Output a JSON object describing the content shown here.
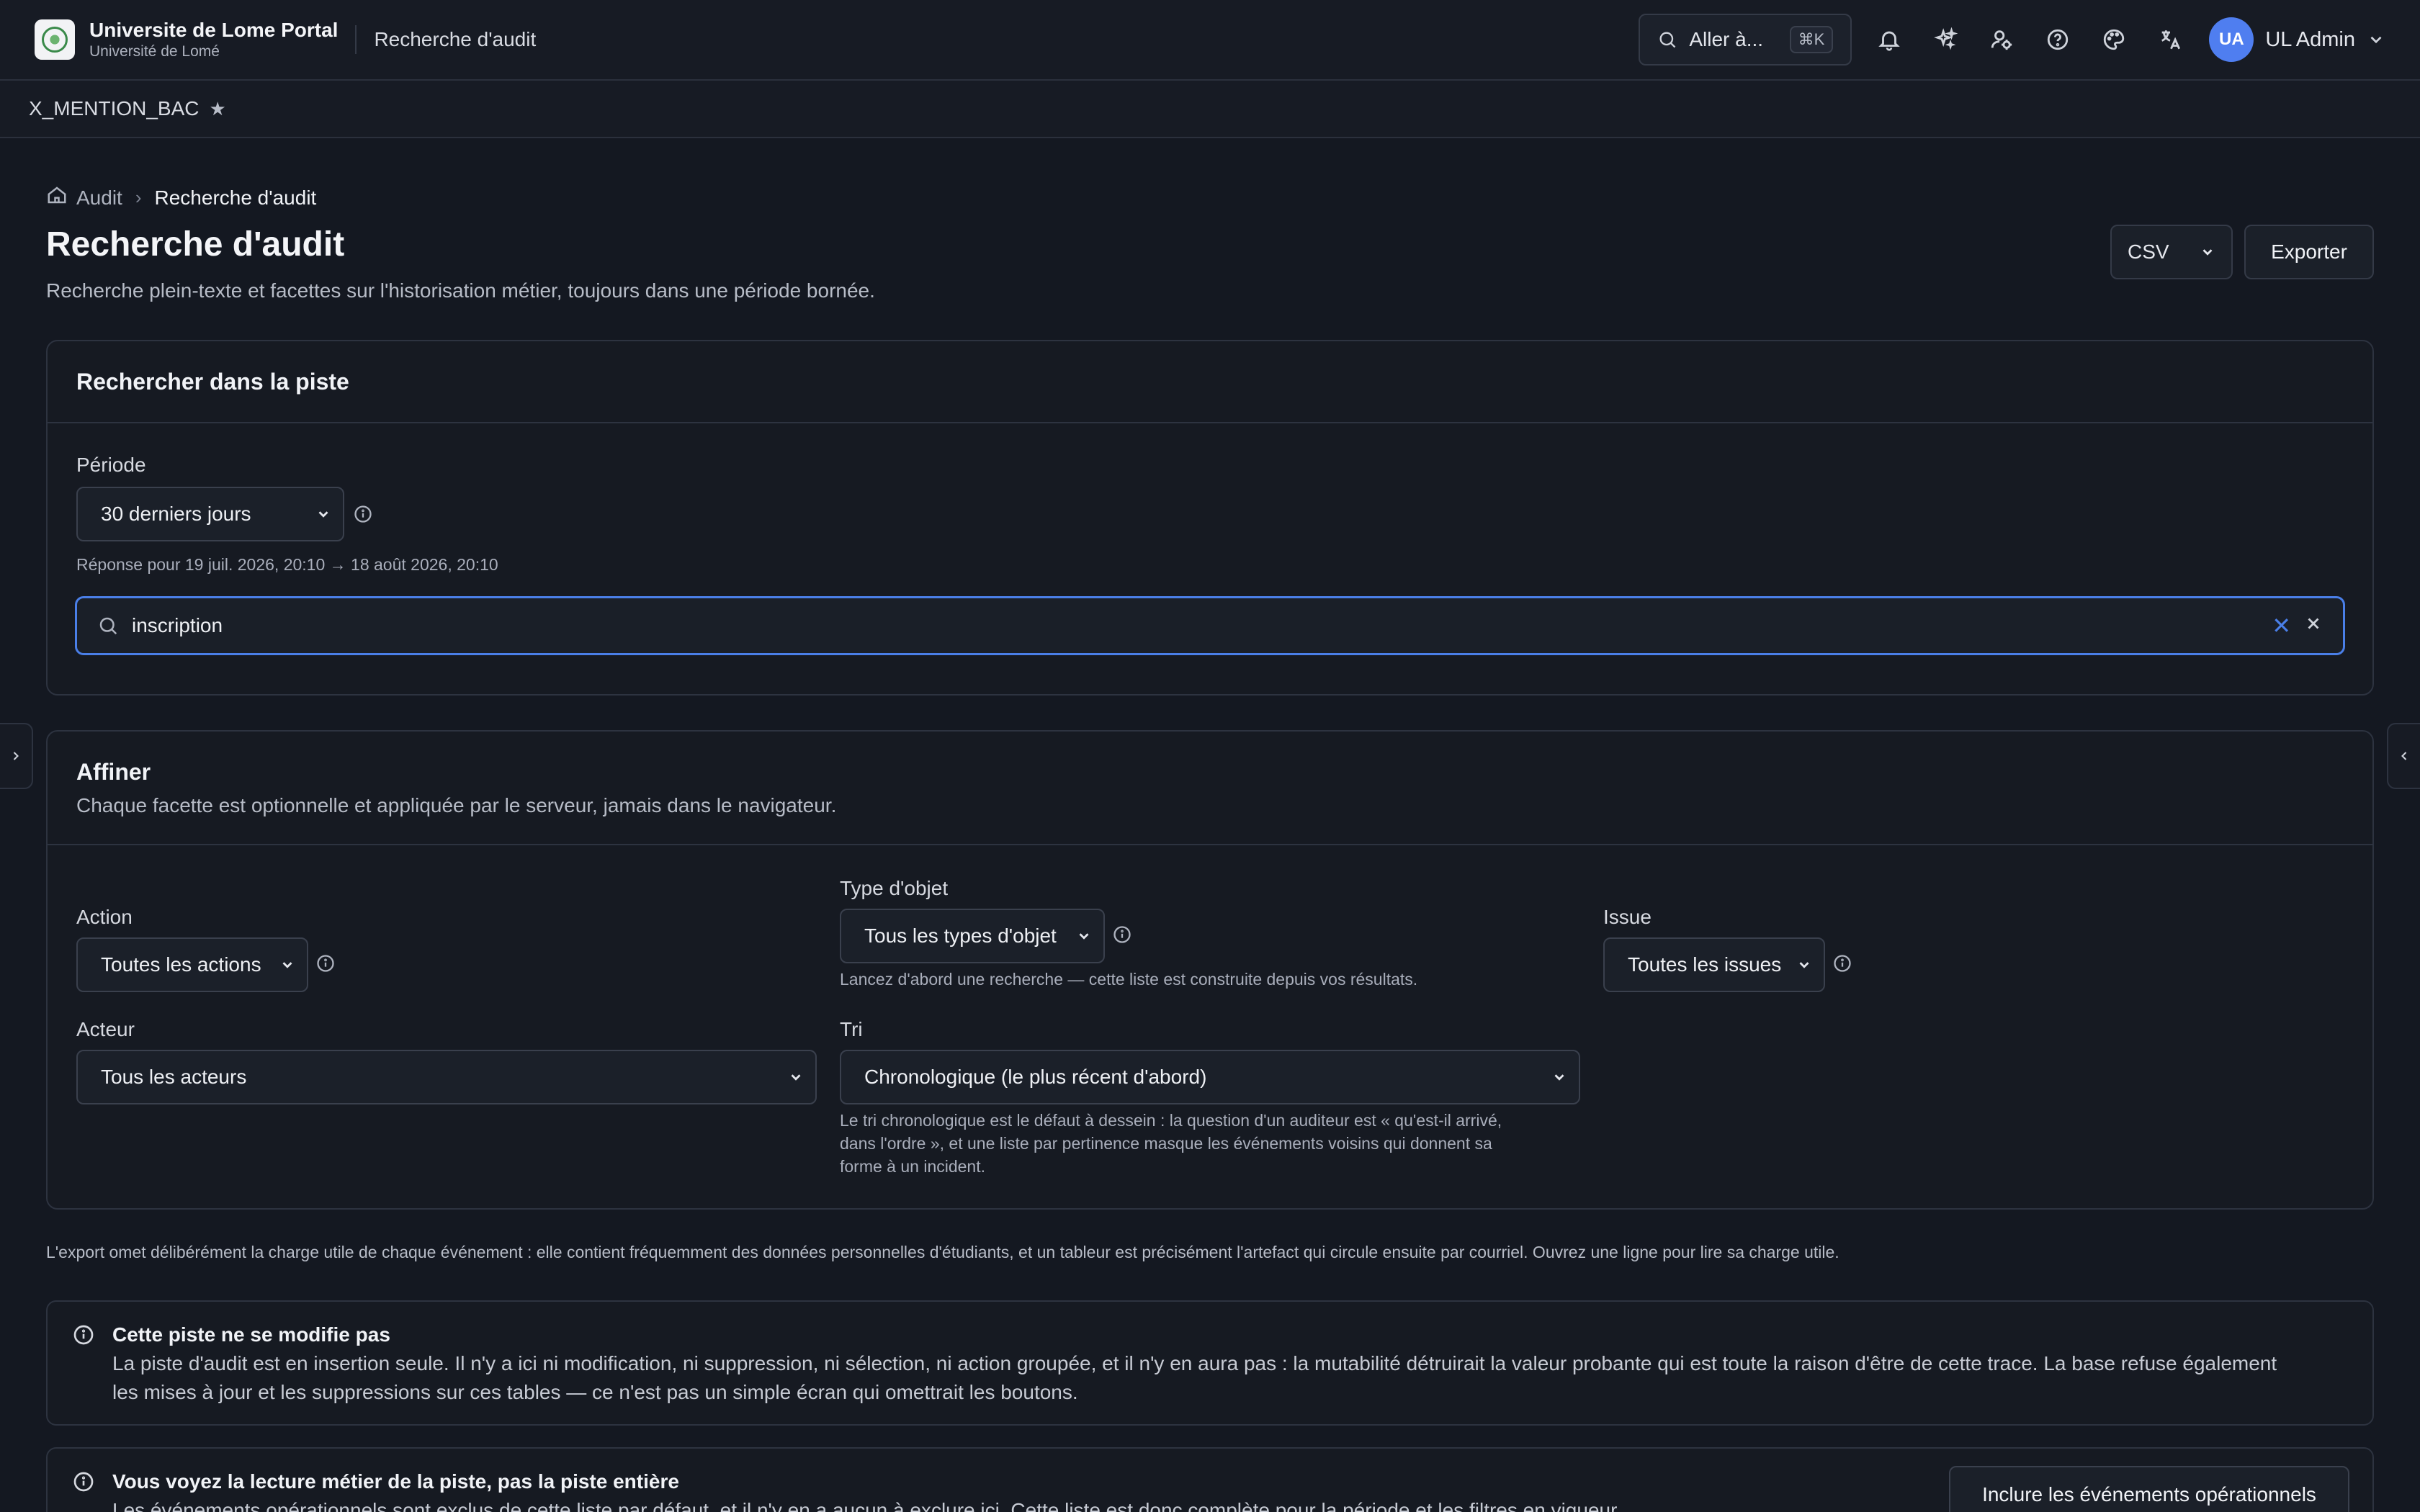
{
  "header": {
    "portal_title": "Universite de Lome Portal",
    "portal_subtitle": "Université de Lomé",
    "current_page": "Recherche d'audit",
    "goto_label": "Aller à...",
    "goto_shortcut": "⌘K",
    "user_initials": "UA",
    "user_name": "UL Admin"
  },
  "tabstrip": {
    "tab_label": "X_MENTION_BAC",
    "star": "★"
  },
  "breadcrumb": {
    "root": "Audit",
    "current": "Recherche d'audit"
  },
  "page": {
    "title": "Recherche d'audit",
    "description": "Recherche plein-texte et facettes sur l'historisation métier, toujours dans une période bornée.",
    "format_select": "CSV",
    "export_label": "Exporter"
  },
  "search_card": {
    "title": "Rechercher dans la piste",
    "period_label": "Période",
    "period_value": "30 derniers jours",
    "period_hint": "Réponse pour 19 juil. 2026, 20:10 → 18 août 2026, 20:10",
    "search_value": "inscription"
  },
  "refine_card": {
    "title": "Affiner",
    "subtitle": "Chaque facette est optionnelle et appliquée par le serveur, jamais dans le navigateur.",
    "action_label": "Action",
    "action_value": "Toutes les actions",
    "object_type_label": "Type d'objet",
    "object_type_value": "Tous les types d'objet",
    "object_type_hint": "Lancez d'abord une recherche — cette liste est construite depuis vos résultats.",
    "outcome_label": "Issue",
    "outcome_value": "Toutes les issues",
    "actor_label": "Acteur",
    "actor_value": "Tous les acteurs",
    "sort_label": "Tri",
    "sort_value": "Chronologique (le plus récent d'abord)",
    "sort_hint_1": "Le tri chronologique est le défaut à dessein : la question d'un auditeur est « qu'est-il arrivé,",
    "sort_hint_2": "dans l'ordre », et une liste par pertinence masque les événements voisins qui donnent sa",
    "sort_hint_3": "forme à un incident."
  },
  "export_note": "L'export omet délibérément la charge utile de chaque événement : elle contient fréquemment des données personnelles d'étudiants, et un tableur est précisément l'artefact qui circule ensuite par courriel. Ouvrez une ligne pour lire sa charge utile.",
  "alerts": [
    {
      "title": "Cette piste ne se modifie pas",
      "body_1": "La piste d'audit est en insertion seule. Il n'y a ici ni modification, ni suppression, ni sélection, ni action groupée, et il n'y en aura pas : la mutabilité détruirait la valeur probante qui est toute la raison d'être de cette trace. La base refuse également",
      "body_2": "les mises à jour et les suppressions sur ces tables — ce n'est pas un simple écran qui omettrait les boutons."
    },
    {
      "title": "Vous voyez la lecture métier de la piste, pas la piste entière",
      "body_1": "Les événements opérationnels sont exclus de cette liste par défaut, et il n'y en a aucun à exclure ici. Cette liste est donc complète pour la période et les filtres en vigueur.",
      "button": "Inclure les événements opérationnels"
    }
  ],
  "colors": {
    "accent": "#4a7fe8",
    "background": "#141821",
    "avatar": "#4f7ef0"
  }
}
